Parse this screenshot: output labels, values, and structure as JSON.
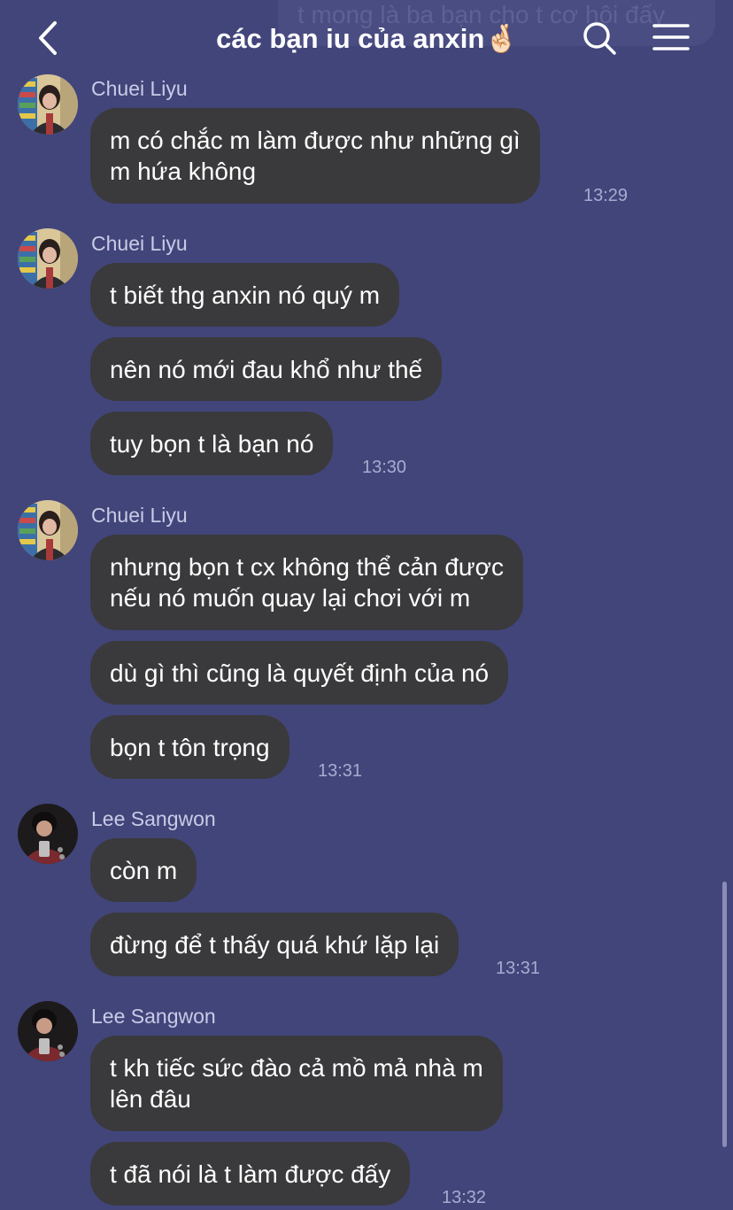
{
  "header": {
    "partial_message": "t mong là ba bạn cho t cơ hội đấy",
    "title": "các bạn iu của anxin🤞🏻",
    "icons": {
      "back": "chevron-left-icon",
      "search": "search-icon",
      "menu": "hamburger-menu-icon"
    }
  },
  "colors": {
    "background": "#42457a",
    "bubble": "#3a3a3c",
    "sender_name": "#c9cbe6",
    "timestamp": "#a8abd0"
  },
  "messages": [
    {
      "sender": "Chuei Liyu",
      "time": "13:29",
      "lines": [
        "m có chắc m làm được như những gì",
        "m hứa không"
      ]
    },
    {
      "sender": "Chuei Liyu",
      "time": "",
      "lines": [
        "t biết thg anxin nó quý m"
      ]
    },
    {
      "sender": "",
      "time": "",
      "lines": [
        "nên nó mới đau khổ như thế"
      ]
    },
    {
      "sender": "",
      "time": "13:30",
      "lines": [
        "tuy bọn t là bạn nó"
      ]
    },
    {
      "sender": "Chuei Liyu",
      "time": "",
      "lines": [
        "nhưng bọn t cx không thể cản được",
        "nếu nó muốn quay lại chơi với m"
      ]
    },
    {
      "sender": "",
      "time": "",
      "lines": [
        "dù gì thì cũng là quyết định của nó"
      ]
    },
    {
      "sender": "",
      "time": "13:31",
      "lines": [
        "bọn t tôn trọng"
      ]
    },
    {
      "sender": "Lee Sangwon",
      "time": "",
      "lines": [
        "còn m"
      ]
    },
    {
      "sender": "",
      "time": "13:31",
      "lines": [
        "đừng để t thấy quá khứ lặp lại"
      ]
    },
    {
      "sender": "Lee Sangwon",
      "time": "",
      "lines": [
        "t kh tiếc sức đào cả mồ mả nhà m",
        "lên đâu"
      ]
    },
    {
      "sender": "",
      "time": "13:32",
      "lines": [
        "t đã nói là t làm được đấy"
      ]
    }
  ]
}
